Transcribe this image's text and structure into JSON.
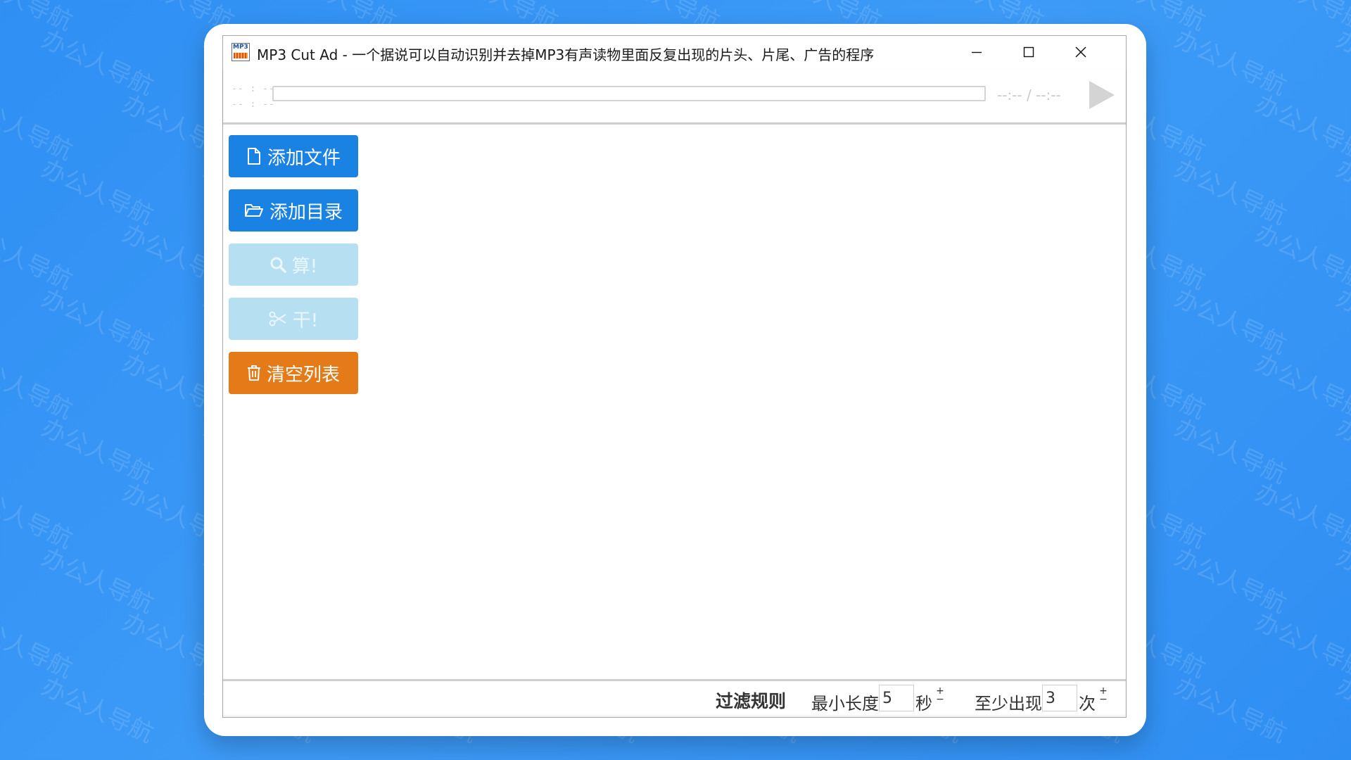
{
  "window": {
    "title": "MP3 Cut Ad - 一个据说可以自动识别并去掉MP3有声读物里面反复出现的片头、片尾、广告的程序",
    "icon_text": "MP3"
  },
  "player": {
    "elapsed_top": "-- : --",
    "elapsed_bottom": "-- : --",
    "time_display": "--:-- / --:--",
    "progress": 0
  },
  "buttons": {
    "add_file": "添加文件",
    "add_dir": "添加目录",
    "compute": "算!",
    "execute": "干!",
    "clear_list": "清空列表"
  },
  "filter": {
    "title": "过滤规则",
    "min_length_label": "最小长度",
    "min_length_value": "5",
    "seconds_unit": "秒",
    "min_occurrence_label": "至少出现",
    "min_occurrence_value": "3",
    "times_unit": "次"
  },
  "background": {
    "watermark_text": "办公人导航"
  },
  "colors": {
    "primary": "#1a82e2",
    "disabled": "#b6e0f2",
    "danger": "#e47b18",
    "desktop": "#3d9bf7"
  }
}
